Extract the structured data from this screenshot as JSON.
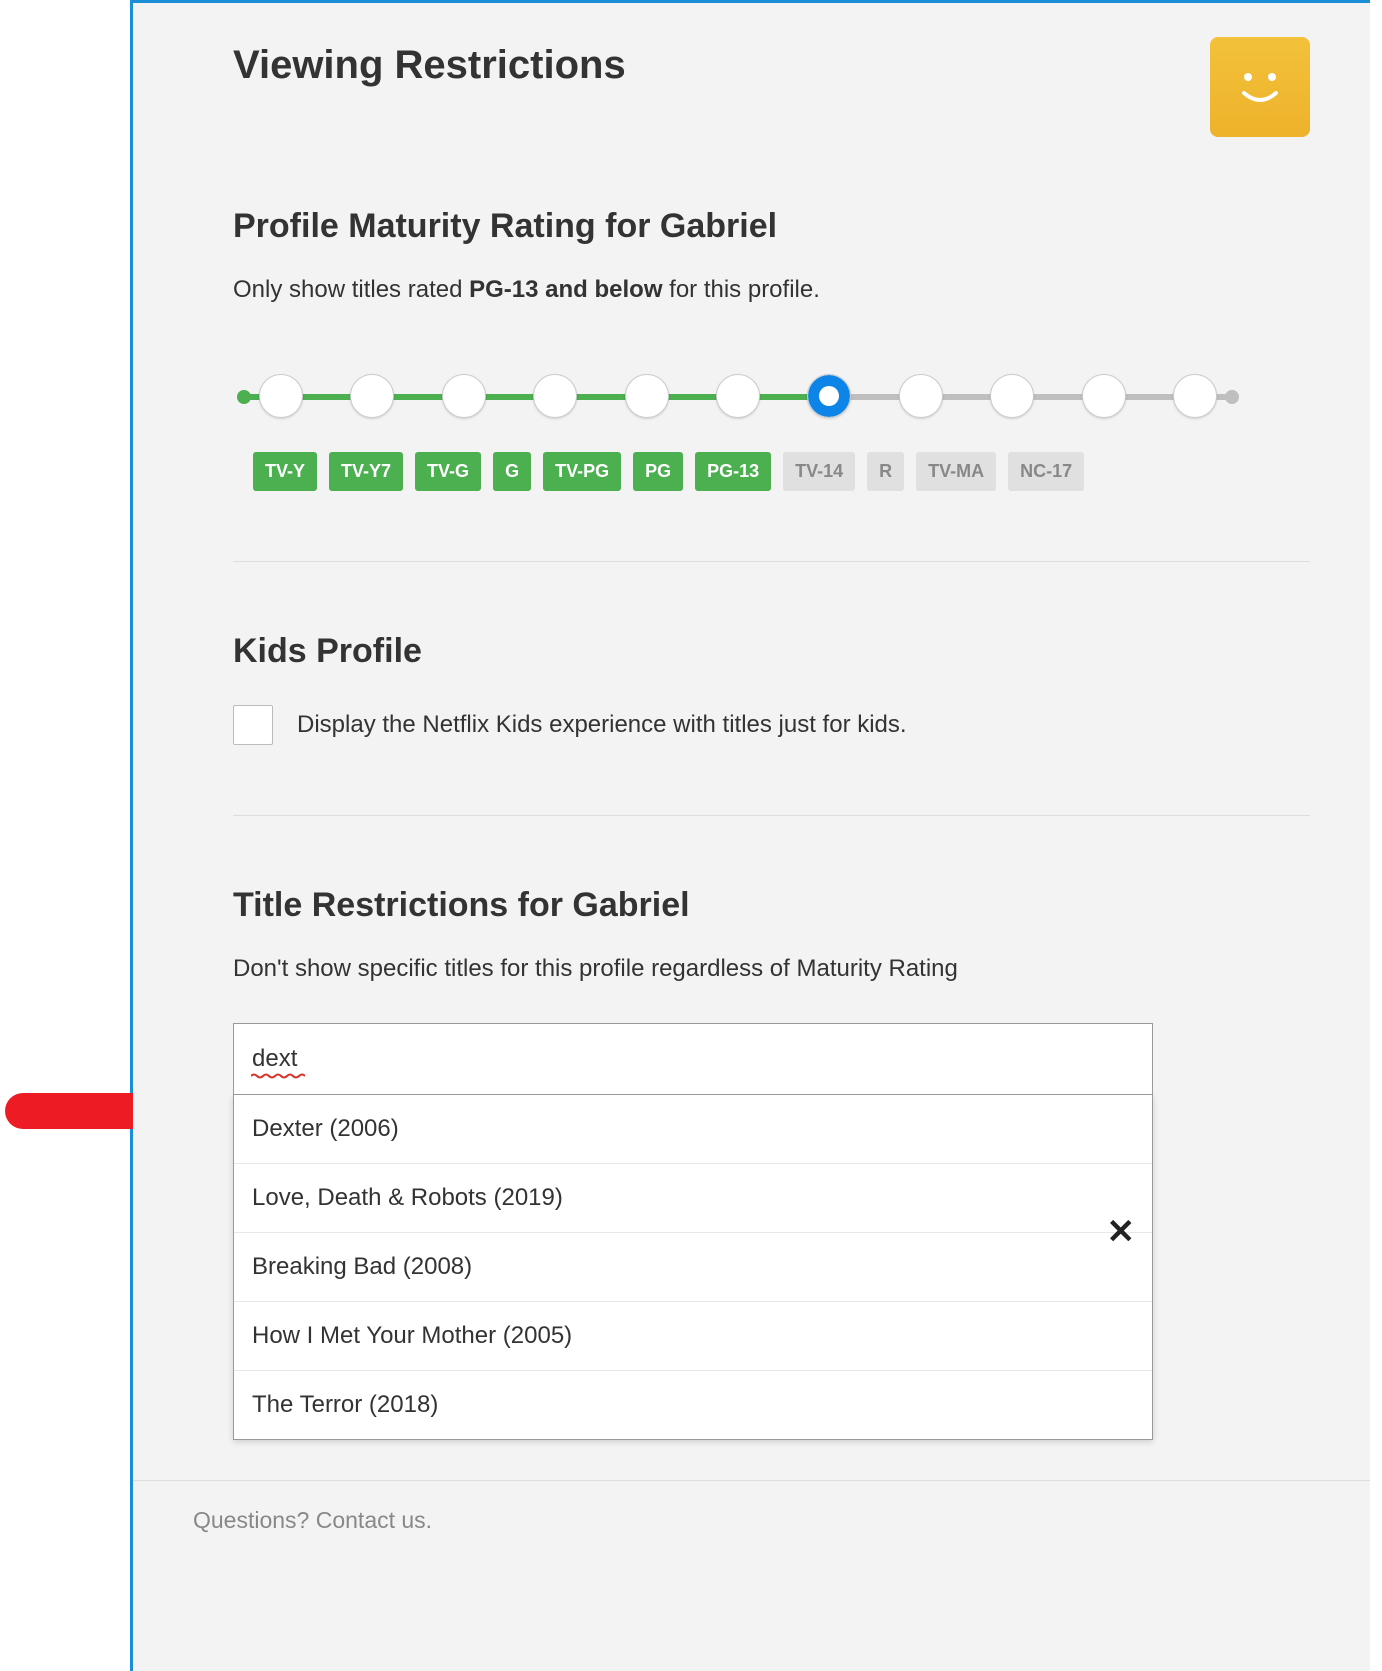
{
  "page_title": "Viewing Restrictions",
  "maturity": {
    "heading": "Profile Maturity Rating for Gabriel",
    "sub_prefix": "Only show titles rated ",
    "sub_bold": "PG-13 and below",
    "sub_suffix": " for this profile.",
    "selected_index": 6,
    "ratings": [
      {
        "label": "TV-Y",
        "active": true
      },
      {
        "label": "TV-Y7",
        "active": true
      },
      {
        "label": "TV-G",
        "active": true
      },
      {
        "label": "G",
        "active": true
      },
      {
        "label": "TV-PG",
        "active": true
      },
      {
        "label": "PG",
        "active": true
      },
      {
        "label": "PG-13",
        "active": true
      },
      {
        "label": "TV-14",
        "active": false
      },
      {
        "label": "R",
        "active": false
      },
      {
        "label": "TV-MA",
        "active": false
      },
      {
        "label": "NC-17",
        "active": false
      }
    ]
  },
  "kids": {
    "heading": "Kids Profile",
    "checkbox_label": "Display the Netflix Kids experience with titles just for kids.",
    "checked": false
  },
  "title_restrictions": {
    "heading": "Title Restrictions for Gabriel",
    "subtext": "Don't show specific titles for this profile regardless of Maturity Rating",
    "search_value": "dext",
    "suggestions": [
      "Dexter (2006)",
      "Love, Death & Robots (2019)",
      "Breaking Bad (2008)",
      "How I Met Your Mother (2005)",
      "The Terror (2018)"
    ]
  },
  "footer": {
    "contact": "Questions? Contact us."
  },
  "colors": {
    "accent_green": "#4caf50",
    "accent_blue": "#0d85e8",
    "avatar_gold": "#f0b82d",
    "annotation_red": "#ed1c24"
  }
}
